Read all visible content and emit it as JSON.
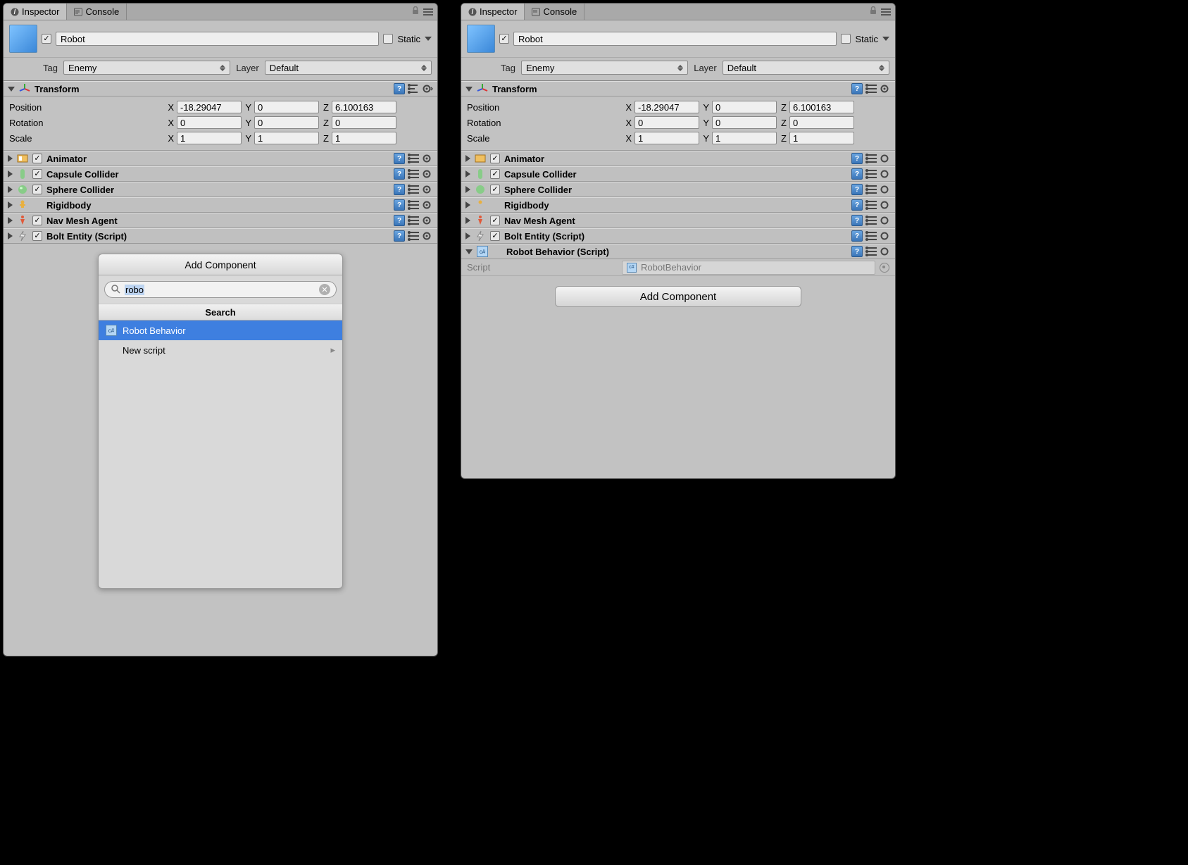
{
  "tabs": {
    "inspector": "Inspector",
    "console": "Console"
  },
  "gameObject": {
    "name": "Robot",
    "static_label": "Static",
    "tag_label": "Tag",
    "tag_value": "Enemy",
    "layer_label": "Layer",
    "layer_value": "Default"
  },
  "transform": {
    "title": "Transform",
    "rows": {
      "position": {
        "label": "Position",
        "x": "-18.29047",
        "y": "0",
        "z": "6.100163"
      },
      "rotation": {
        "label": "Rotation",
        "x": "0",
        "y": "0",
        "z": "0"
      },
      "scale": {
        "label": "Scale",
        "x": "1",
        "y": "1",
        "z": "1"
      }
    },
    "axis": {
      "x": "X",
      "y": "Y",
      "z": "Z"
    }
  },
  "components": {
    "animator": "Animator",
    "capsule": "Capsule Collider",
    "sphere": "Sphere Collider",
    "rigidbody": "Rigidbody",
    "navmesh": "Nav Mesh Agent",
    "bolt": "Bolt Entity (Script)",
    "robot_behavior": "Robot Behavior (Script)"
  },
  "script_row": {
    "label": "Script",
    "value": "RobotBehavior"
  },
  "add_component": "Add Component",
  "popup": {
    "title": "Add Component",
    "search_value": "robo",
    "section": "Search",
    "result": "Robot Behavior",
    "new_script": "New script"
  }
}
